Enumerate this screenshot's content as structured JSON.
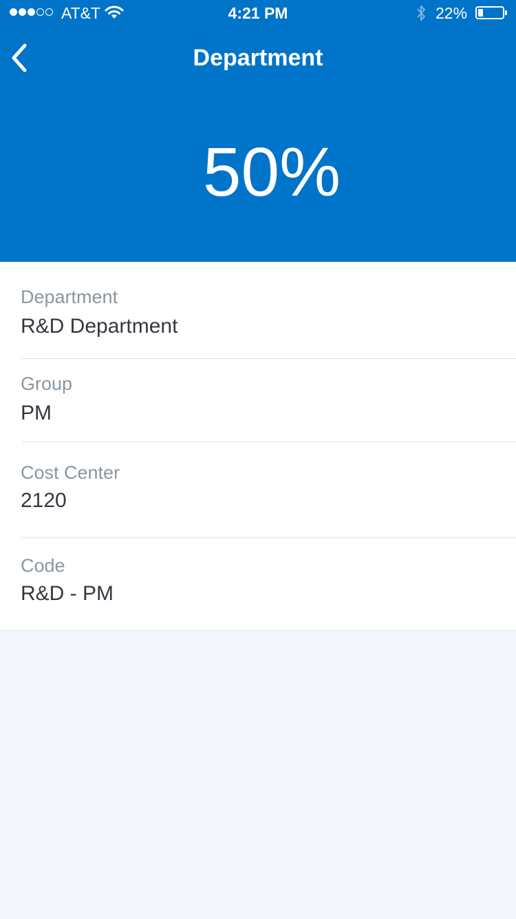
{
  "status_bar": {
    "carrier": "AT&T",
    "time": "4:21 PM",
    "battery_percent": "22%",
    "battery_level": 0.22,
    "signal_bars_filled": 3,
    "signal_bars_total": 5
  },
  "nav": {
    "title": "Department",
    "back_icon": "chevron-left-icon"
  },
  "header": {
    "percent": "50%",
    "background_color": "#0074c8"
  },
  "details": [
    {
      "label": "Department",
      "value": "R&D Department"
    },
    {
      "label": "Group",
      "value": "PM"
    },
    {
      "label": "Cost Center",
      "value": "2120"
    },
    {
      "label": "Code",
      "value": "R&D - PM"
    }
  ]
}
